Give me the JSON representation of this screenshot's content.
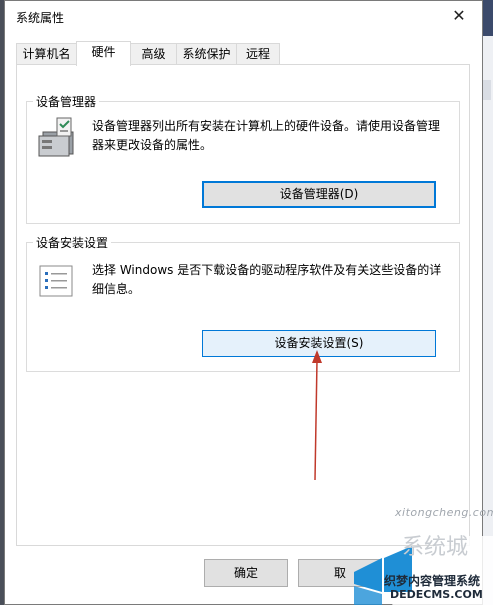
{
  "window": {
    "title": "系统属性",
    "close_symbol": "✕"
  },
  "tabs": [
    {
      "label": "计算机名"
    },
    {
      "label": "硬件",
      "active": true
    },
    {
      "label": "高级"
    },
    {
      "label": "系统保护"
    },
    {
      "label": "远程"
    }
  ],
  "device_manager": {
    "group_title": "设备管理器",
    "description": "设备管理器列出所有安装在计算机上的硬件设备。请使用设备管理器来更改设备的属性。",
    "button_label": "设备管理器(D)",
    "icon": "device-manager-icon"
  },
  "device_installation": {
    "group_title": "设备安装设置",
    "description": "选择 Windows 是否下载设备的驱动程序软件及有关这些设备的详细信息。",
    "button_label": "设备安装设置(S)",
    "icon": "settings-list-icon"
  },
  "footer": {
    "ok_label": "确定",
    "cancel_label": "取"
  },
  "watermark": {
    "url": "xitongcheng.com",
    "site_name": "织梦内容管理系统",
    "domain": "DEDECMS.COM"
  },
  "colors": {
    "accent": "#0078d7",
    "annotation_arrow": "#c0392b"
  }
}
